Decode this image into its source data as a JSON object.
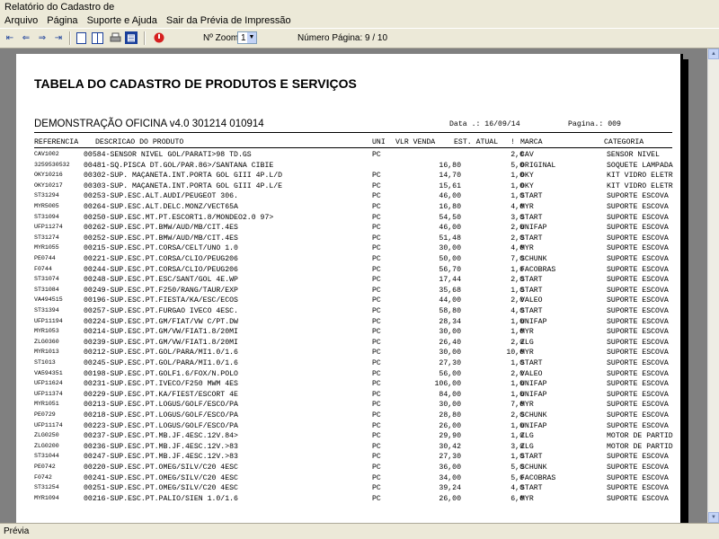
{
  "window": {
    "title": "Relatório do Cadastro de"
  },
  "menu": [
    "Arquivo",
    "Página",
    "Suporte e Ajuda",
    "Sair da Prévia de Impressão"
  ],
  "toolbar": {
    "zoom_label": "Nº Zoom",
    "zoom_value": "1",
    "page_label": "Número Página: 9 / 10"
  },
  "report": {
    "title": "TABELA DO CADASTRO DE PRODUTOS E SERVIÇOS",
    "company": "DEMONSTRAÇÃO OFICINA v4.0 301214 010914",
    "date": "Data .: 16/09/14",
    "page": "Pagina.: 009",
    "headers": {
      "ref": "REFERENCIA",
      "desc": "DESCRICAO DO PRODUTO",
      "uni": "UNI",
      "vlr": "VLR VENDA",
      "est": "EST. ATUAL",
      "sep": "!",
      "marca": "MARCA",
      "cat": "CATEGORIA"
    },
    "rows": [
      [
        "CAV1002",
        "00584-SENSOR NIVEL GOL/PARATI>98 TD.GS",
        "PC",
        "",
        "2,0",
        "CAV",
        "SENSOR NIVEL"
      ],
      [
        "3259530532",
        "00481-SQ.PISCA DT.GOL/PAR.86>/SANTANA CIBIE",
        "",
        "16,80",
        "5,0",
        "ORIGINAL",
        "SOQUETE LAMPADA"
      ],
      [
        "OKY10216",
        "00302-SUP. MAÇANETA.INT.PORTA GOL GIII 4P.L/D",
        "PC",
        "14,70",
        "1,0",
        "OKY",
        "KIT VIDRO ELETR"
      ],
      [
        "OKY10217",
        "00303-SUP. MAÇANETA.INT.PORTA GOL GIII 4P.L/E",
        "PC",
        "15,61",
        "1,0",
        "OKY",
        "KIT VIDRO ELETR"
      ],
      [
        "ST31294",
        "00253-SUP.ESC.ALT.AUDI/PEUGEOT 306.",
        "PC",
        "46,00",
        "1,0",
        "START",
        "SUPORTE ESCOVA"
      ],
      [
        "MYR5005",
        "00264-SUP.ESC.ALT.DELC.MONZ/VECT65A",
        "PC",
        "16,80",
        "4,0",
        "MYR",
        "SUPORTE ESCOVA"
      ],
      [
        "ST31094",
        "00250-SUP.ESC.MT.PT.ESCORT1.8/MONDEO2.0 97>",
        "PC",
        "54,50",
        "3,0",
        "START",
        "SUPORTE ESCOVA"
      ],
      [
        "UFP11274",
        "00262-SUP.ESC.PT.BMW/AUD/MB/CIT.4ES",
        "PC",
        "46,00",
        "2,0",
        "UNIFAP",
        "SUPORTE ESCOVA"
      ],
      [
        "ST31274",
        "00252-SUP.ESC.PT.BMW/AUD/MB/CIT.4ES",
        "PC",
        "51,48",
        "2,0",
        "START",
        "SUPORTE ESCOVA"
      ],
      [
        "MYR1055",
        "00215-SUP.ESC.PT.CORSA/CELT/UNO 1.0",
        "PC",
        "30,00",
        "4,0",
        "MYR",
        "SUPORTE ESCOVA"
      ],
      [
        "PE0744",
        "00221-SUP.ESC.PT.CORSA/CLIO/PEUG206",
        "PC",
        "50,00",
        "7,0",
        "SCHUNK",
        "SUPORTE ESCOVA"
      ],
      [
        "F0744",
        "00244-SUP.ESC.PT.CORSA/CLIO/PEUG206",
        "PC",
        "56,70",
        "1,0",
        "FACOBRAS",
        "SUPORTE ESCOVA"
      ],
      [
        "ST31074",
        "00248-SUP.ESC.PT.ESC/SANT/GOL 4E.WP",
        "PC",
        "17,44",
        "2,0",
        "START",
        "SUPORTE ESCOVA"
      ],
      [
        "ST31084",
        "00249-SUP.ESC.PT.F250/RANG/TAUR/EXP",
        "PC",
        "35,68",
        "1,0",
        "START",
        "SUPORTE ESCOVA"
      ],
      [
        "VA494515",
        "00196-SUP.ESC.PT.FIESTA/KA/ESC/ECOS",
        "PC",
        "44,00",
        "2,0",
        "VALEO",
        "SUPORTE ESCOVA"
      ],
      [
        "ST31394",
        "00257-SUP.ESC.PT.FURGAO IVECO 4ESC.",
        "PC",
        "58,80",
        "4,0",
        "START",
        "SUPORTE ESCOVA"
      ],
      [
        "UFP11194",
        "00224-SUP.ESC.PT.GM/FIAT/VW C/PT.DW",
        "PC",
        "28,34",
        "1,0",
        "UNIFAP",
        "SUPORTE ESCOVA"
      ],
      [
        "MYR1053",
        "00214-SUP.ESC.PT.GM/VW/FIAT1.8/20MI",
        "PC",
        "30,00",
        "1,0",
        "MYR",
        "SUPORTE ESCOVA"
      ],
      [
        "ZLG0360",
        "00239-SUP.ESC.PT.GM/VW/FIAT1.8/20MI",
        "PC",
        "26,40",
        "2,0",
        "ZLG",
        "SUPORTE ESCOVA"
      ],
      [
        "MYR1013",
        "00212-SUP.ESC.PT.GOL/PARA/MI1.0/1.6",
        "PC",
        "30,00",
        "10,0",
        "MYR",
        "SUPORTE ESCOVA"
      ],
      [
        "ST1013",
        "00245-SUP.ESC.PT.GOL/PARA/MI1.0/1.6",
        "PC",
        "27,30",
        "1,0",
        "START",
        "SUPORTE ESCOVA"
      ],
      [
        "VA594351",
        "00198-SUP.ESC.PT.GOLF1.6/FOX/N.POLO",
        "PC",
        "56,00",
        "2,0",
        "VALEO",
        "SUPORTE ESCOVA"
      ],
      [
        "UFP11624",
        "00231-SUP.ESC.PT.IVECO/F250 MWM 4ES",
        "PC",
        "106,00",
        "1,0",
        "UNIFAP",
        "SUPORTE ESCOVA"
      ],
      [
        "UFP11374",
        "00229-SUP.ESC.PT.KA/FIEST/ESCORT 4E",
        "PC",
        "84,00",
        "1,0",
        "UNIFAP",
        "SUPORTE ESCOVA"
      ],
      [
        "MYR1051",
        "00213-SUP.ESC.PT.LOGUS/GOLF/ESCO/PA",
        "PC",
        "30,00",
        "7,0",
        "MYR",
        "SUPORTE ESCOVA"
      ],
      [
        "PE0729",
        "00218-SUP.ESC.PT.LOGUS/GOLF/ESCO/PA",
        "PC",
        "28,80",
        "2,0",
        "SCHUNK",
        "SUPORTE ESCOVA"
      ],
      [
        "UFP11174",
        "00223-SUP.ESC.PT.LOGUS/GOLF/ESCO/PA",
        "PC",
        "26,00",
        "1,0",
        "UNIFAP",
        "SUPORTE ESCOVA"
      ],
      [
        "ZLG0250",
        "00237-SUP.ESC.PT.MB.JF.4ESC.12V.84>",
        "PC",
        "29,90",
        "1,0",
        "ZLG",
        "MOTOR DE PARTID"
      ],
      [
        "ZLG0200",
        "00236-SUP.ESC.PT.MB.JF.4ESC.12V.>83",
        "PC",
        "30,42",
        "3,0",
        "ZLG",
        "MOTOR DE PARTID"
      ],
      [
        "ST31044",
        "00247-SUP.ESC.PT.MB.JF.4ESC.12V.>83",
        "PC",
        "27,30",
        "1,0",
        "START",
        "SUPORTE ESCOVA"
      ],
      [
        "PE0742",
        "00220-SUP.ESC.PT.OMEG/SILV/C20 4ESC",
        "PC",
        "36,00",
        "5,0",
        "SCHUNK",
        "SUPORTE ESCOVA"
      ],
      [
        "F0742",
        "00241-SUP.ESC.PT.OMEG/SILV/C20 4ESC",
        "PC",
        "34,00",
        "5,0",
        "FACOBRAS",
        "SUPORTE ESCOVA"
      ],
      [
        "ST31254",
        "00251-SUP.ESC.PT.OMEG/SILV/C20 4ESC",
        "PC",
        "39,24",
        "4,0",
        "START",
        "SUPORTE ESCOVA"
      ],
      [
        "MYR1094",
        "00216-SUP.ESC.PT.PALIO/SIEN 1.0/1.6",
        "PC",
        "26,00",
        "6,0",
        "MYR",
        "SUPORTE ESCOVA"
      ]
    ]
  },
  "statusbar": {
    "text": "Prévia"
  }
}
